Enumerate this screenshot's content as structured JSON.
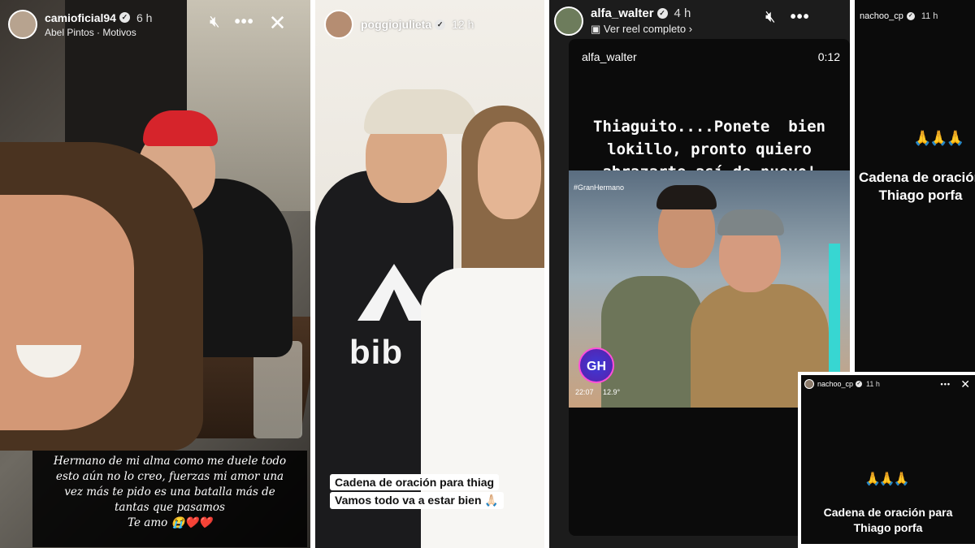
{
  "panels": [
    {
      "username": "camioficial94",
      "time": "6 h",
      "music": "Abel Pintos · Motivos",
      "caption_lines": [
        "Hermano de mi alma como me duele todo",
        "esto aún no lo creo, fuerzas mi amor una",
        "vez más te pido es una batalla más de",
        "tantas que pasamos",
        "Te amo 😭❤️❤️"
      ]
    },
    {
      "username": "poggiojulieta",
      "time": "12 h",
      "hoodie_text": "bib",
      "caption_lines": [
        "Cadena de oración para thiag",
        "Vamos todo va a estar bien 🙏🏻"
      ]
    },
    {
      "username": "alfa_walter",
      "time": "4 h",
      "reel_link": "Ver reel completo",
      "reel_user": "alfa_walter",
      "reel_duration": "0:12",
      "reel_text_lines": [
        "Thiaguito....Ponete  bien",
        "lokillo, pronto quiero",
        "abrazarte así de nuevo!"
      ],
      "tv_tag": "#GranHermano",
      "tv_logo": "GH",
      "tv_clock": "22:07",
      "tv_temp": "12.9°"
    },
    {
      "username": "nachoo_cp",
      "time": "11 h",
      "emoji": "🙏🙏🙏",
      "caption_lines": [
        "Cadena de oración",
        "Thiago porfa"
      ]
    },
    {
      "username": "nachoo_cp",
      "time": "11 h",
      "emoji": "🙏🙏🙏",
      "caption_lines": [
        "Cadena de oración para",
        "Thiago porfa"
      ]
    }
  ],
  "icons": [
    "mute-icon",
    "more-icon",
    "close-icon",
    "chevron-right-icon",
    "verified-icon"
  ],
  "colors": {
    "story_black": "#0b0b0b",
    "caption_bg": "#000000",
    "white": "#ffffff"
  }
}
